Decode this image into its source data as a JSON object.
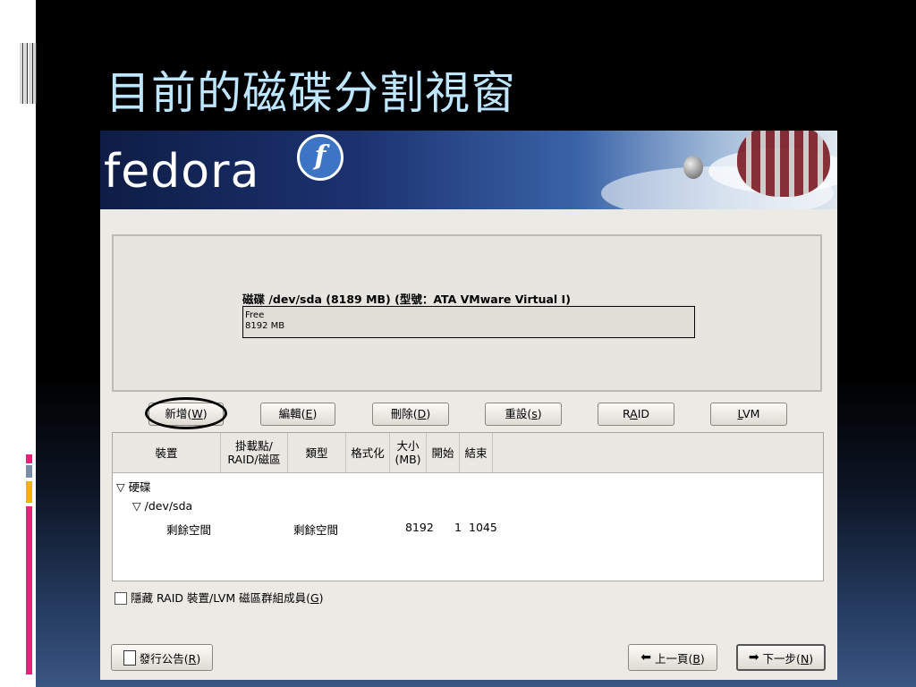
{
  "slide": {
    "title": "目前的磁碟分割視窗",
    "accent_colors": [
      "#e8207a",
      "#7a8ca8",
      "#f0b400",
      "#e8207a"
    ]
  },
  "installer": {
    "logo": "fedora",
    "logo_badge": "f",
    "disk": {
      "label": "磁碟 /dev/sda (8189 MB) (型號：ATA VMware Virtual I)",
      "segment_name": "Free",
      "segment_size": "8192 MB"
    },
    "buttons": {
      "new": {
        "text": "新增(",
        "key": "W",
        "end": ")"
      },
      "edit": {
        "text": "編輯(",
        "key": "E",
        "end": ")"
      },
      "delete": {
        "text": "刪除(",
        "key": "D",
        "end": ")"
      },
      "reset": {
        "text": "重設(",
        "key": "s",
        "end": ")"
      },
      "raid": {
        "pre": "R",
        "key": "A",
        "post": "ID"
      },
      "lvm": {
        "key": "L",
        "post": "VM"
      }
    },
    "table": {
      "headers": {
        "device": "裝置",
        "mount_line1": "掛載點/",
        "mount_line2": "RAID/磁區",
        "type": "類型",
        "format": "格式化",
        "size_line1": "大小",
        "size_line2": "(MB)",
        "start": "開始",
        "end": "結束"
      },
      "tree": {
        "root": "硬碟",
        "device": "/dev/sda",
        "free_row": {
          "device": "剩餘空間",
          "type": "剩餘空間",
          "size": "8192",
          "start": "1",
          "end": "1045"
        }
      }
    },
    "hide_raid_checkbox": {
      "label_pre": "隱藏 RAID 裝置/LVM 磁區群組成員(",
      "key": "G",
      "label_end": ")",
      "checked": false
    },
    "release_notes": {
      "text": "發行公告(",
      "key": "R",
      "end": ")"
    },
    "back": {
      "text": "上一頁(",
      "key": "B",
      "end": ")"
    },
    "next": {
      "text": "下一步(",
      "key": "N",
      "end": ")"
    }
  }
}
